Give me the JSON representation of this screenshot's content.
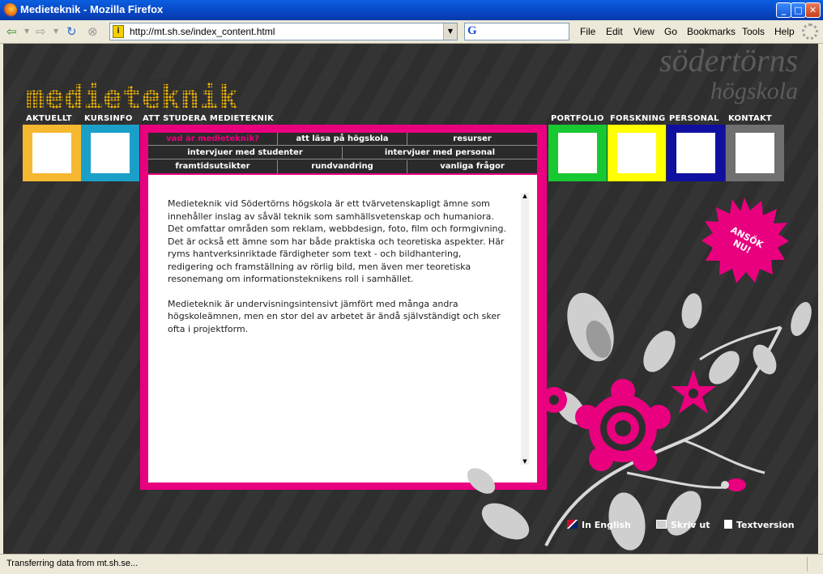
{
  "window": {
    "title": "Medieteknik - Mozilla Firefox",
    "min_label": "_",
    "max_label": "□",
    "close_label": "✕"
  },
  "toolbar": {
    "url": "http://mt.sh.se/index_content.html",
    "search_logo": "G",
    "menu": [
      "File",
      "Edit",
      "View",
      "Go",
      "Bookmarks",
      "Tools",
      "Help"
    ]
  },
  "page": {
    "logo_text": "medieteknik",
    "university_logo": [
      "södertörns",
      "högskola"
    ],
    "left_tabs": [
      {
        "label": "AKTUELLT",
        "color": "#f5b830"
      },
      {
        "label": "KURSINFO",
        "color": "#1aa0c8"
      }
    ],
    "center_tab_label": "ATT STUDERA MEDIETEKNIK",
    "right_tabs": [
      {
        "label": "PORTFOLIO",
        "color": "#18c830"
      },
      {
        "label": "FORSKNING",
        "color": "#ffff00"
      },
      {
        "label": "PERSONAL",
        "color": "#1010a0"
      },
      {
        "label": "KONTAKT",
        "color": "#707070"
      }
    ],
    "subnav": {
      "row1": [
        "vad är medieteknik?",
        "att läsa på högskola",
        "resurser"
      ],
      "row2": [
        "intervjuer med studenter",
        "intervjuer med personal"
      ],
      "row3": [
        "framtidsutsikter",
        "rundvandring",
        "vanliga frågor"
      ]
    },
    "body_paragraphs": [
      "Medieteknik vid Södertörns högskola är ett tvärvetenskapligt ämne som innehåller inslag av såväl teknik som samhällsvetenskap och humaniora. Det omfattar områden som reklam, webbdesign, foto, film och formgivning. Det är också ett ämne som har både praktiska och teoretiska aspekter. Här ryms hantverksinriktade färdigheter som text - och bildhantering, redigering och framställning av rörlig bild, men även mer teoretiska resonemang om informationsteknikens roll i samhället.",
      "Medieteknik är undervisningsintensivt jämfört med många andra högskoleämnen, men en stor del av arbetet är ändå självständigt och sker ofta i projektform."
    ],
    "apply_badge": "ANSÖK NU!",
    "footer": {
      "english": "In English",
      "print": "Skriv ut",
      "text_version": "Textversion"
    },
    "accent_color": "#e9007e"
  },
  "status": {
    "message": "Transferring data from mt.sh.se..."
  }
}
